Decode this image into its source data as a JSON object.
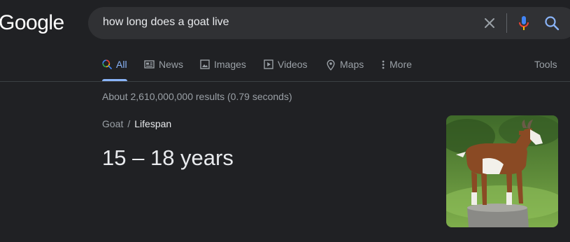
{
  "logo": "Google",
  "search": {
    "query": "how long does a goat live"
  },
  "tabs": [
    {
      "label": "All",
      "icon": "search-icon",
      "active": true
    },
    {
      "label": "News",
      "icon": "news-icon"
    },
    {
      "label": "Images",
      "icon": "images-icon"
    },
    {
      "label": "Videos",
      "icon": "videos-icon"
    },
    {
      "label": "Maps",
      "icon": "maps-pin-icon"
    },
    {
      "label": "More",
      "icon": "more-vert-icon"
    }
  ],
  "tools_label": "Tools",
  "result_stats": "About 2,610,000,000 results (0.79 seconds)",
  "breadcrumb": {
    "parent": "Goat",
    "separator": "/",
    "current": "Lifespan"
  },
  "answer": "15 – 18 years",
  "colors": {
    "background": "#202124",
    "accent": "#8ab4f8",
    "search_box": "#303134"
  }
}
